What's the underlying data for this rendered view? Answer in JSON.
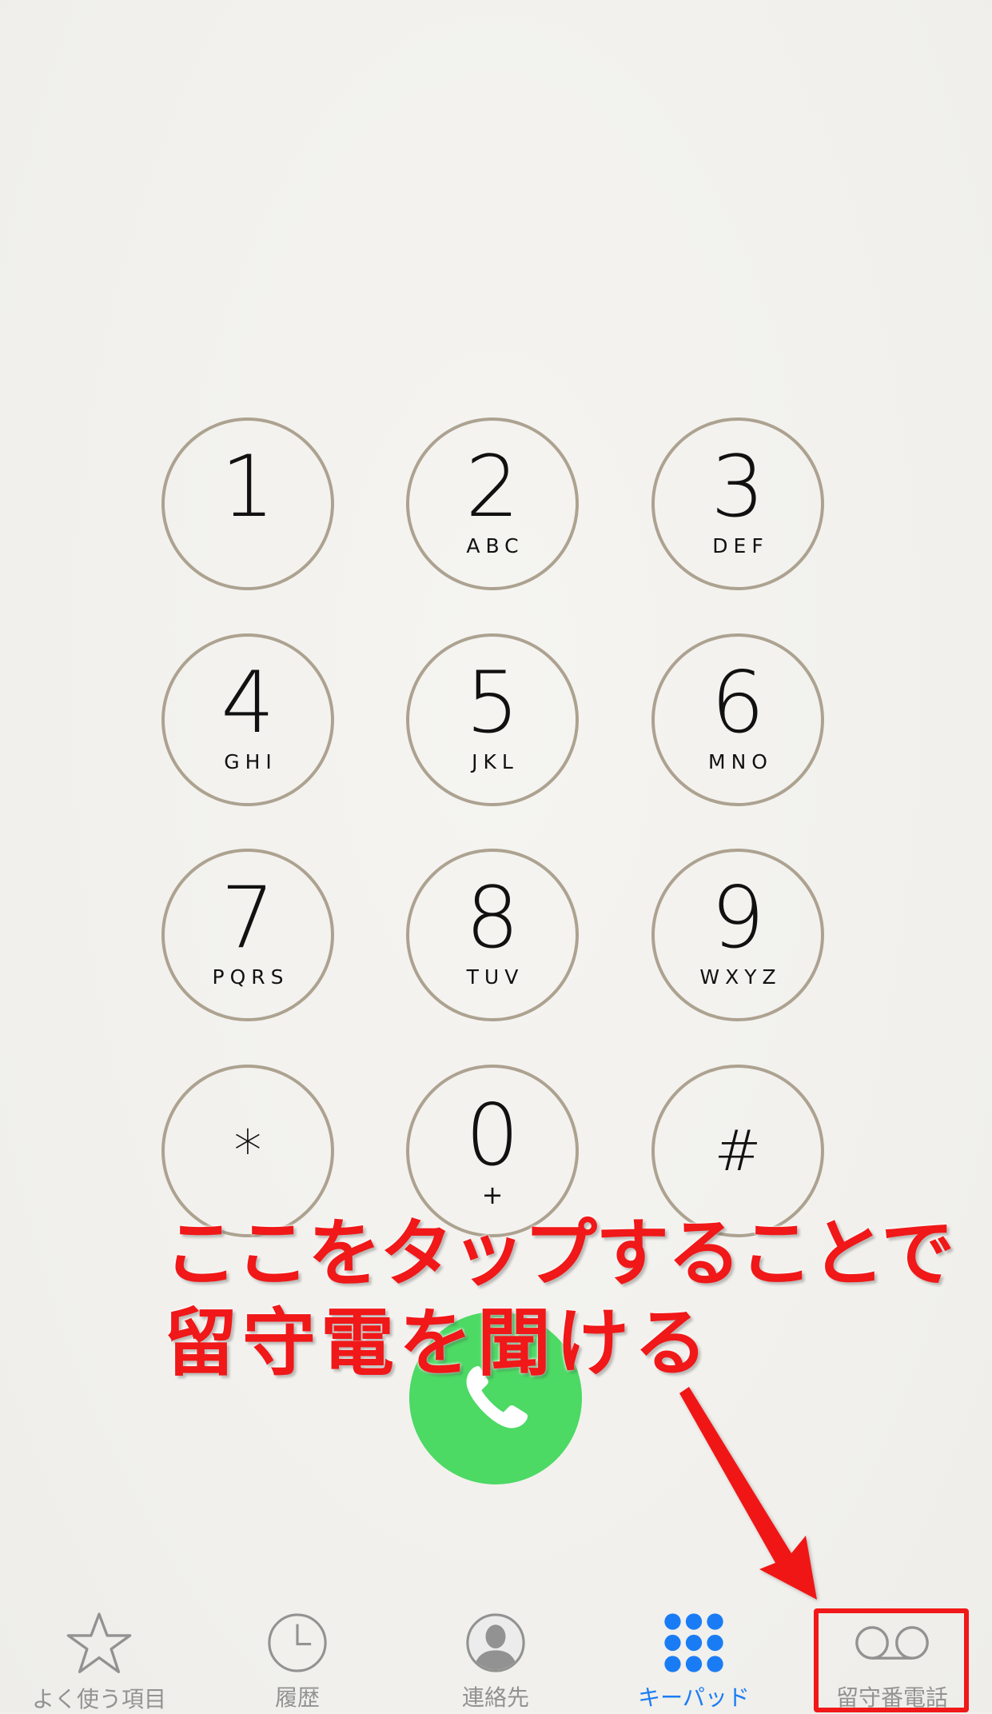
{
  "keypad": {
    "keys": [
      {
        "digit": "1",
        "letters": ""
      },
      {
        "digit": "2",
        "letters": "ABC"
      },
      {
        "digit": "3",
        "letters": "DEF"
      },
      {
        "digit": "4",
        "letters": "GHI"
      },
      {
        "digit": "5",
        "letters": "JKL"
      },
      {
        "digit": "6",
        "letters": "MNO"
      },
      {
        "digit": "7",
        "letters": "PQRS"
      },
      {
        "digit": "8",
        "letters": "TUV"
      },
      {
        "digit": "9",
        "letters": "WXYZ"
      },
      {
        "digit": "*",
        "letters": ""
      },
      {
        "digit": "0",
        "letters": "+"
      },
      {
        "digit": "#",
        "letters": ""
      }
    ],
    "ring_color": "#ada290"
  },
  "call_button": {
    "icon": "phone-handset-icon",
    "color": "#4cd964"
  },
  "annotation": {
    "line1": "ここをタップすることで",
    "line2": "留守電を聞ける",
    "color": "#f01818"
  },
  "tabbar": {
    "tabs": [
      {
        "label": "よく使う項目",
        "icon": "star-icon"
      },
      {
        "label": "履歴",
        "icon": "clock-icon"
      },
      {
        "label": "連絡先",
        "icon": "contact-icon"
      },
      {
        "label": "キーパッド",
        "icon": "keypad-icon",
        "active": true
      },
      {
        "label": "留守番電話",
        "icon": "voicemail-icon"
      }
    ],
    "active_color": "#1a7cf5",
    "inactive_color": "#929292"
  }
}
